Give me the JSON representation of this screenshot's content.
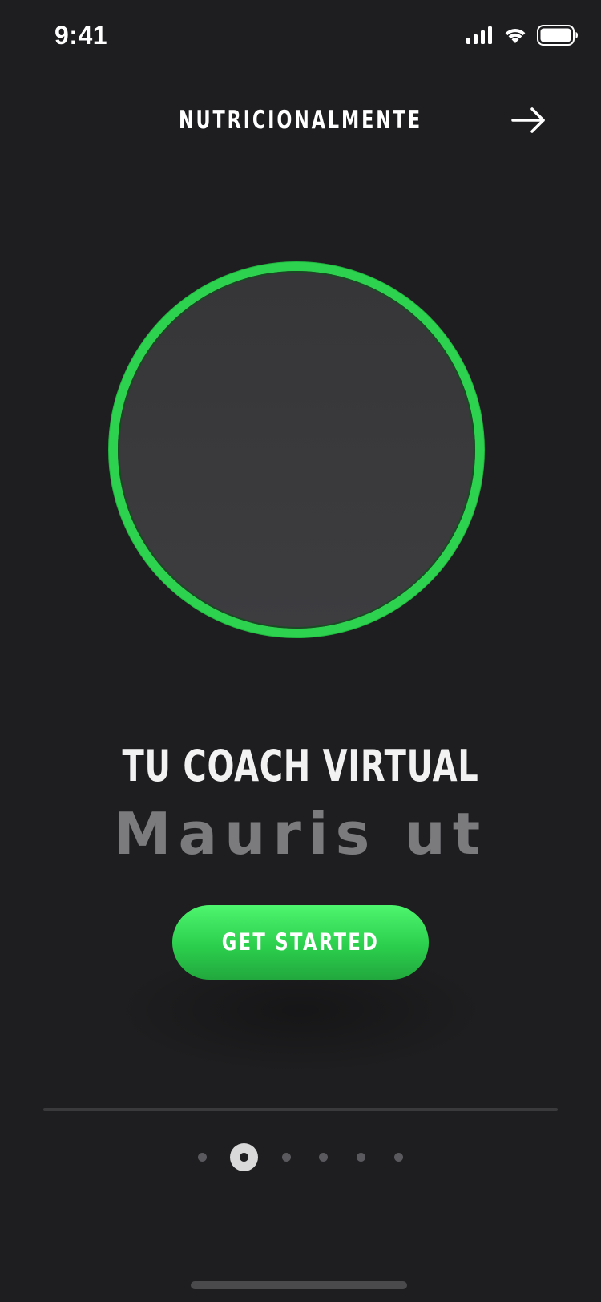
{
  "status_bar": {
    "time": "9:41",
    "icons": [
      "signal-icon",
      "wifi-icon",
      "battery-icon"
    ]
  },
  "header": {
    "title": "NUTRICIONALMENTE",
    "next_icon": "arrow-right-icon"
  },
  "hero": {
    "avatar_ring_color": "#2dd34f"
  },
  "content": {
    "headline": "TU COACH VIRTUAL",
    "subheadline": "Mauris ut"
  },
  "cta": {
    "label": "GET STARTED",
    "color": "#2dd34f"
  },
  "pager": {
    "total_pages": 6,
    "active_index": 1
  },
  "colors": {
    "background": "#1e1e20",
    "accent": "#2dd34f",
    "muted_text": "#7b7b7e"
  }
}
